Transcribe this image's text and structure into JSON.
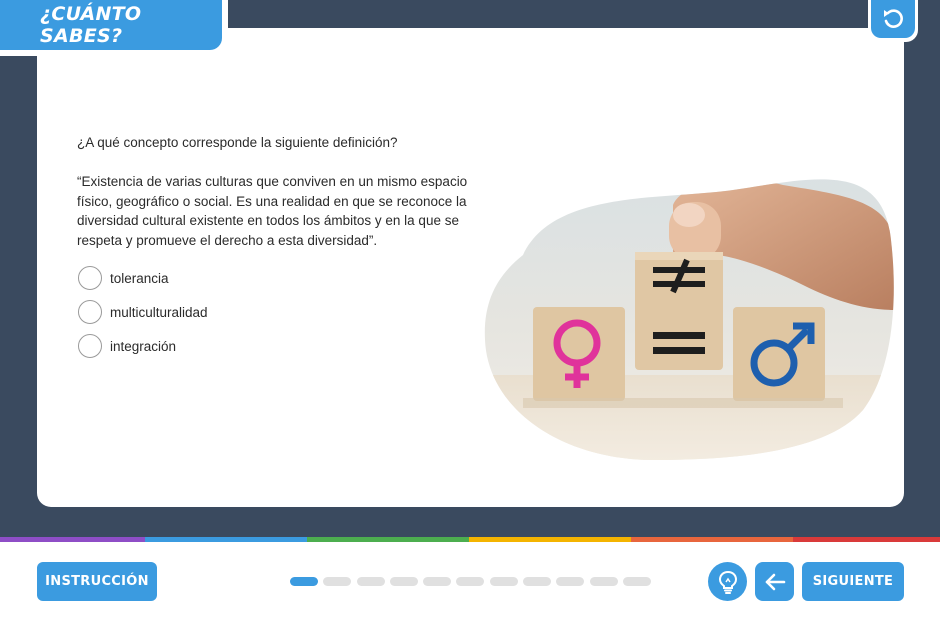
{
  "header": {
    "title": "¿CUÁNTO SABES?"
  },
  "icons": {
    "reset": "undo-icon",
    "hint": "lightbulb-icon",
    "back": "arrow-left-icon"
  },
  "quiz": {
    "question": "¿A qué concepto corresponde la siguiente definición?",
    "definition": "“Existencia de varias culturas que conviven en un mismo espacio físico, geográfico o social. Es una realidad en que se reconoce la diversidad cultural existente en todos los ámbitos y en la que se respeta y promueve el derecho a esta diversidad”.",
    "options": [
      "tolerancia",
      "multiculturalidad",
      "integración"
    ]
  },
  "footer": {
    "instruction_label": "INSTRUCCIÓN",
    "next_label": "SIGUIENTE",
    "progress": {
      "current": 1,
      "total": 11
    }
  },
  "colors": {
    "accent": "#3b9be0",
    "frame": "#3a4a5f",
    "rainbow": [
      "#8e4ec6",
      "#3b9be0",
      "#4cae4f",
      "#f4b400",
      "#e8663d",
      "#d93a3a"
    ]
  }
}
